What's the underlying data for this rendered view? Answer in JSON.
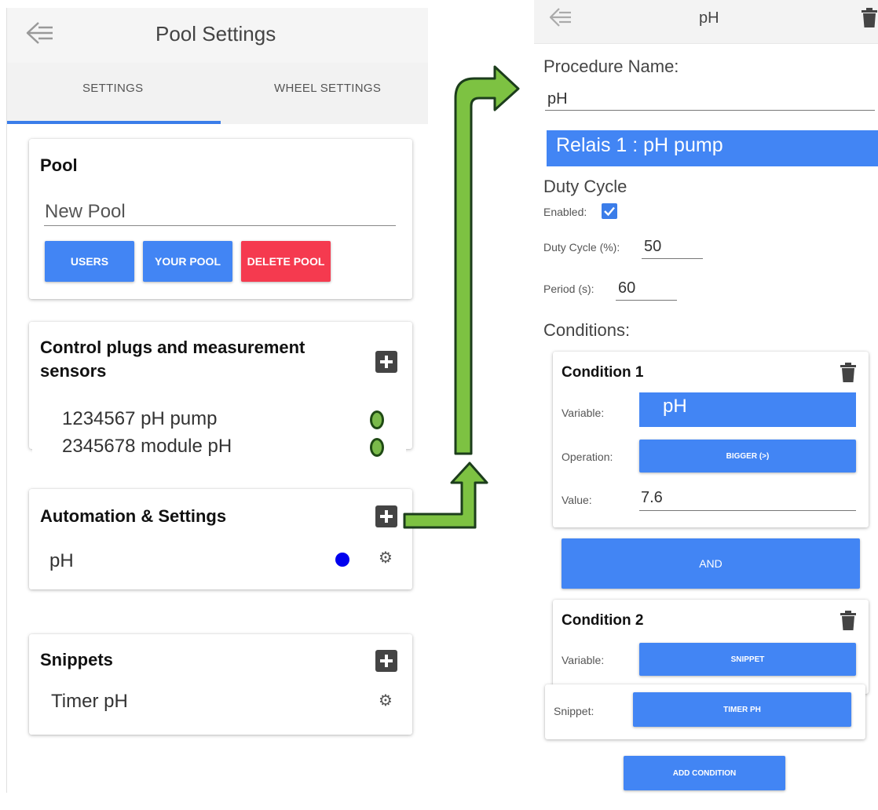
{
  "left": {
    "header_title": "Pool Settings",
    "tabs": [
      "SETTINGS",
      "WHEEL SETTINGS"
    ],
    "pool_card": {
      "title": "Pool",
      "pool_name": "New Pool",
      "buttons": {
        "users": "USERS",
        "your_pool": "YOUR POOL",
        "delete_pool": "DELETE POOL"
      }
    },
    "plugs_card": {
      "title_line1": "Control plugs and measurement",
      "title_line2": "sensors",
      "items": [
        "1234567 pH pump",
        "2345678 module pH"
      ]
    },
    "automation_card": {
      "title": "Automation & Settings",
      "items": [
        "pH"
      ]
    },
    "snippets_card": {
      "title": "Snippets",
      "items": [
        "Timer pH"
      ]
    }
  },
  "right": {
    "header_title": "pH",
    "procedure_label": "Procedure Name:",
    "procedure_value": "pH",
    "relay_label": "Relais 1 : pH pump",
    "duty_cycle": {
      "title": "Duty Cycle",
      "enabled_label": "Enabled:",
      "enabled": true,
      "percent_label": "Duty Cycle (%):",
      "percent_value": "50",
      "period_label": "Period (s):",
      "period_value": "60"
    },
    "conditions_label": "Conditions:",
    "condition1": {
      "title": "Condition 1",
      "variable_label": "Variable:",
      "variable_value": "pH",
      "operation_label": "Operation:",
      "operation_value": "BIGGER (>)",
      "value_label": "Value:",
      "value": "7.6"
    },
    "and_label": "AND",
    "condition2": {
      "title": "Condition 2",
      "variable_label": "Variable:",
      "variable_value": "SNIPPET",
      "snippet_label": "Snippet:",
      "snippet_value": "TIMER PH"
    },
    "add_condition": "ADD CONDITION"
  },
  "colors": {
    "primary": "#4285f4",
    "danger": "#f53a4f",
    "tab_indicator": "#3b7de9",
    "arrow_fill": "#7dc242",
    "arrow_stroke": "#1c3d1c",
    "status_blue": "#0000ee"
  }
}
